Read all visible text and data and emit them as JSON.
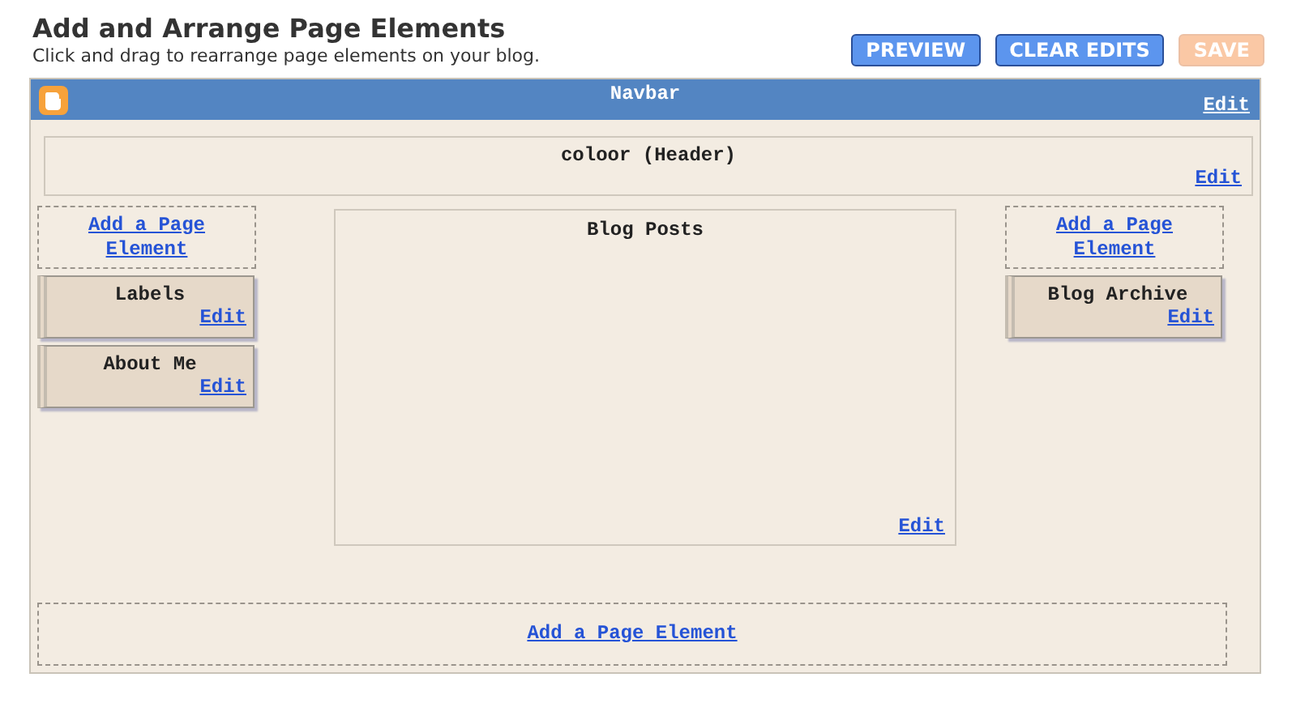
{
  "title": "Add and Arrange Page Elements",
  "subtitle": "Click and drag to rearrange page elements on your blog.",
  "buttons": [
    {
      "label": "PREVIEW",
      "disabled": false
    },
    {
      "label": "CLEAR EDITS",
      "disabled": false
    },
    {
      "label": "SAVE",
      "disabled": true
    }
  ],
  "navbar": {
    "title": "Navbar",
    "edit": "Edit"
  },
  "header": {
    "title": "coloor (Header)",
    "edit": "Edit"
  },
  "left_sidebar": {
    "add_link": "Add a Page Element",
    "widgets": [
      {
        "title": "Labels",
        "edit": "Edit"
      },
      {
        "title": "About Me",
        "edit": "Edit"
      }
    ]
  },
  "main": {
    "title": "Blog Posts",
    "edit": "Edit"
  },
  "right_sidebar": {
    "add_link": "Add a Page Element",
    "widgets": [
      {
        "title": "Blog Archive",
        "edit": "Edit"
      }
    ]
  },
  "footer": {
    "add_link": "Add a Page Element"
  }
}
